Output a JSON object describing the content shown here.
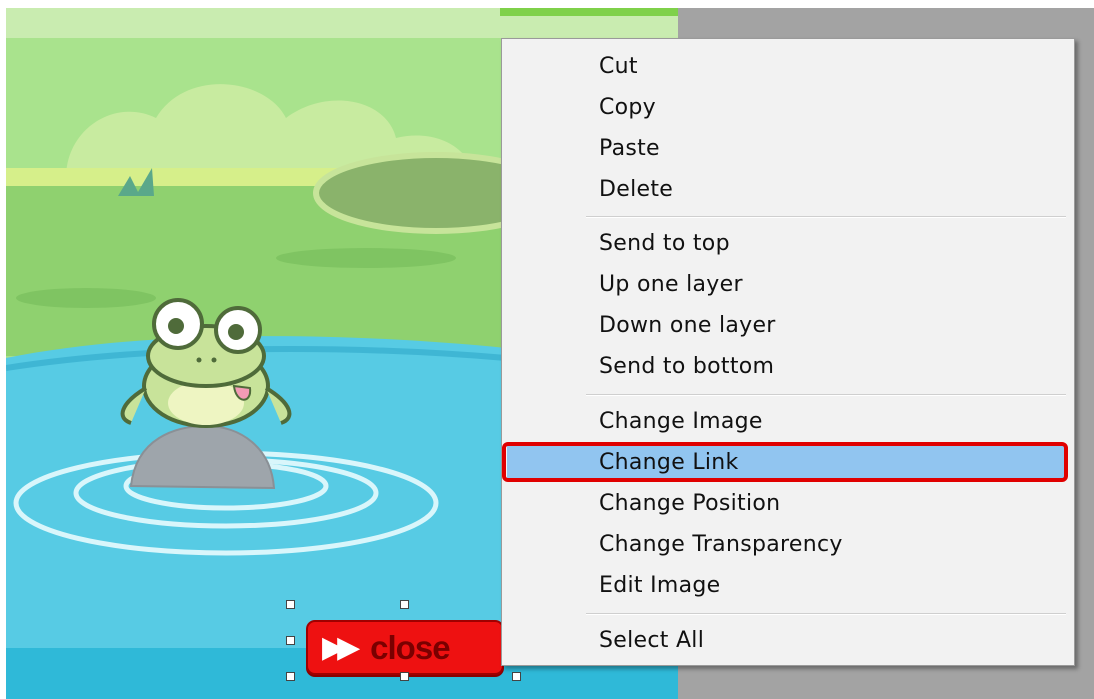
{
  "context_menu": {
    "groups": [
      [
        "Cut",
        "Copy",
        "Paste",
        "Delete"
      ],
      [
        "Send to top",
        "Up one layer",
        "Down one layer",
        "Send to bottom"
      ],
      [
        "Change Image",
        "Change Link",
        "Change Position",
        "Change Transparency",
        "Edit Image"
      ],
      [
        "Select All"
      ]
    ],
    "highlighted_item": "Change Link"
  },
  "selected_element": {
    "label": "close",
    "arrow_glyph": "▶▶"
  },
  "colors": {
    "highlight_row": "#91c5f0",
    "annotation_border": "#e00000",
    "button_red": "#ee1111",
    "gray_workspace": "#a3a3a3"
  }
}
